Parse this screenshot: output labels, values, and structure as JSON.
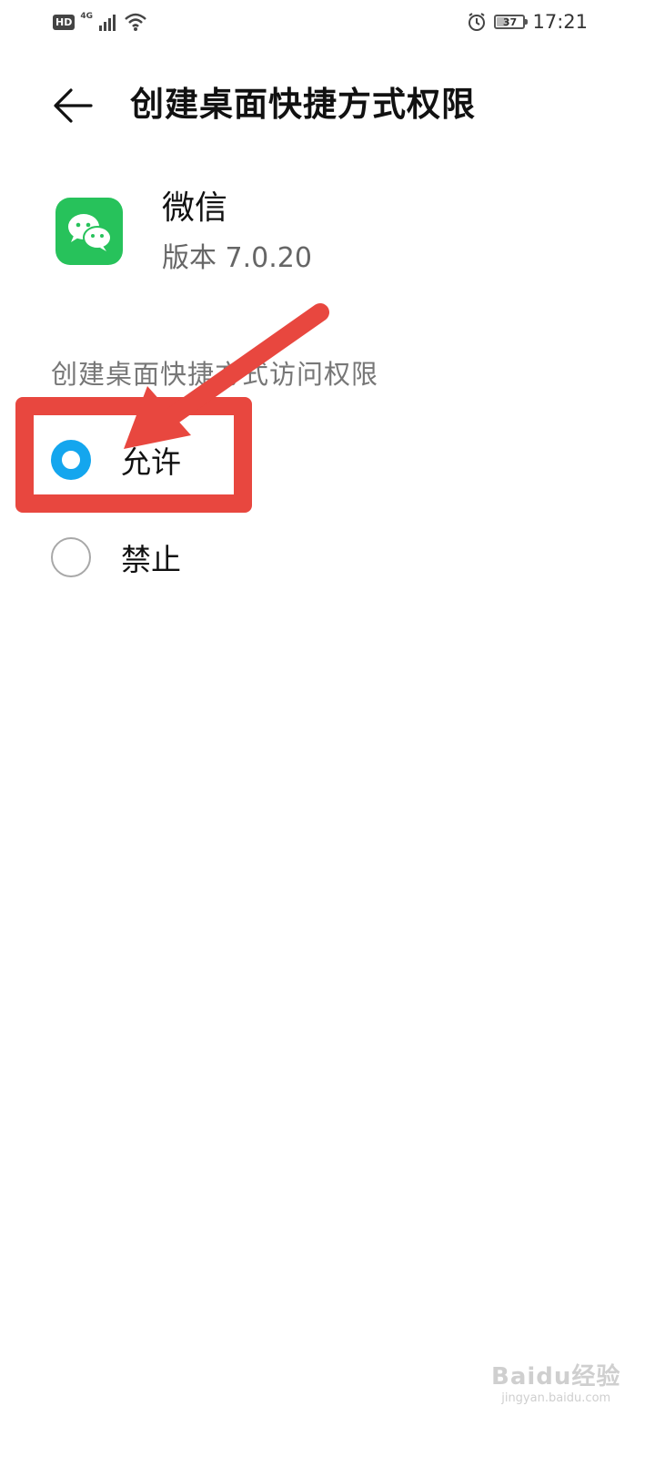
{
  "status_bar": {
    "hd": "HD",
    "network": "4G",
    "battery": "37",
    "time": "17:21"
  },
  "header": {
    "title": "创建桌面快捷方式权限"
  },
  "app": {
    "name": "微信",
    "version": "版本 7.0.20",
    "icon": "wechat-icon",
    "icon_color": "#27c25b"
  },
  "permission": {
    "section_label": "创建桌面快捷方式访问权限",
    "options": [
      {
        "label": "允许",
        "selected": true
      },
      {
        "label": "禁止",
        "selected": false
      }
    ]
  },
  "colors": {
    "accent": "#14a6ee",
    "annotation": "#e8473f"
  },
  "watermark": {
    "main": "Baidu经验",
    "sub": "jingyan.baidu.com"
  }
}
